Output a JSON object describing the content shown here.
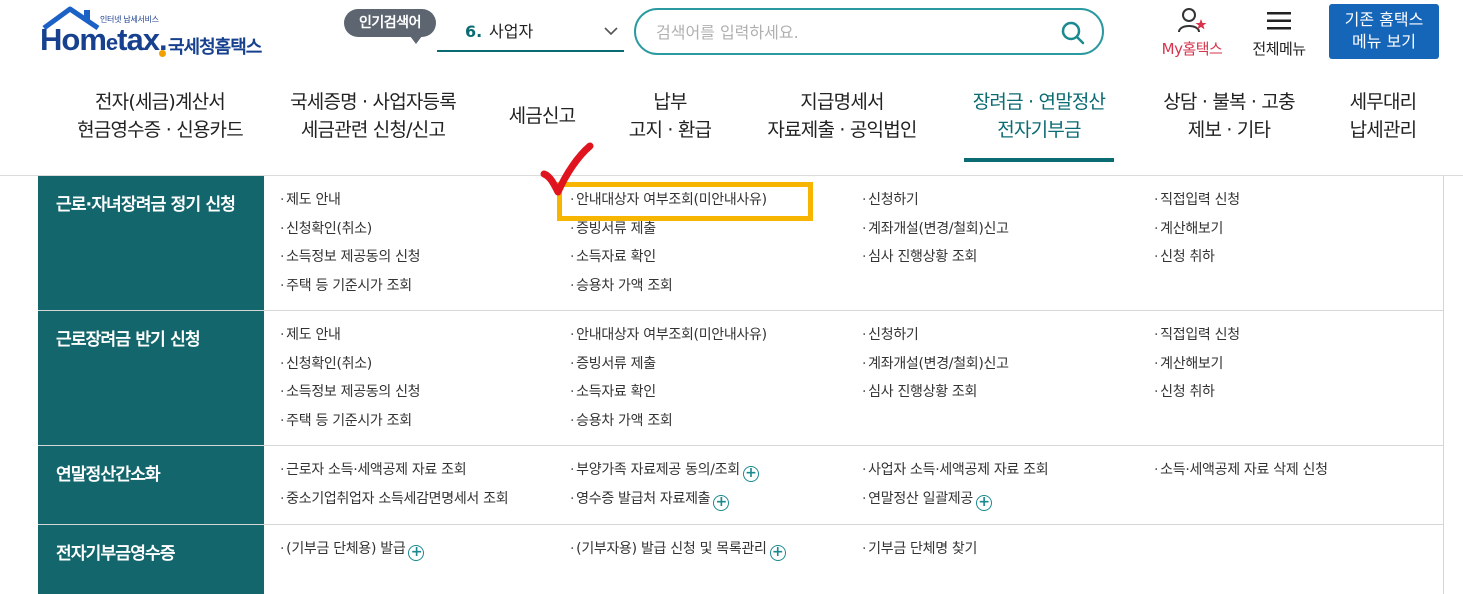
{
  "logo": {
    "subtitle": "인터넷 납세서비스",
    "word_main": "Hom",
    "word_e": "e",
    "word_end": "tax.",
    "korean_name": "국세청홈택스"
  },
  "popular": {
    "badge": "인기검색어",
    "rank": "6.",
    "term": "사업자"
  },
  "search": {
    "placeholder": "검색어를 입력하세요."
  },
  "header": {
    "my_hometax": "My홈택스",
    "all_menu": "전체메뉴",
    "classic_line1": "기존 홈택스",
    "classic_line2": "메뉴 보기"
  },
  "gnb": [
    {
      "line1": "전자(세금)계산서",
      "line2": "현금영수증 · 신용카드"
    },
    {
      "line1": "국세증명 · 사업자등록",
      "line2": "세금관련 신청/신고"
    },
    {
      "line1": "세금신고",
      "line2": ""
    },
    {
      "line1": "납부",
      "line2": "고지 · 환급"
    },
    {
      "line1": "지급명세서",
      "line2": "자료제출 · 공익법인"
    },
    {
      "line1": "장려금 · 연말정산",
      "line2": "전자기부금"
    },
    {
      "line1": "상담 · 불복 · 고충",
      "line2": "제보 · 기타"
    },
    {
      "line1": "세무대리",
      "line2": "납세관리"
    }
  ],
  "sections": [
    {
      "title": "근로·자녀장려금 정기 신청",
      "links": [
        "제도 안내",
        "신청확인(취소)",
        "소득정보 제공동의 신청",
        "주택 등 기준시가 조회",
        "안내대상자 여부조회(미안내사유)",
        "증빙서류 제출",
        "소득자료 확인",
        "승용차 가액 조회",
        "신청하기",
        "계좌개설(변경/철회)신고",
        "심사 진행상황 조회",
        "직접입력 신청",
        "계산해보기",
        "신청 취하"
      ]
    },
    {
      "title": "근로장려금 반기 신청",
      "links": [
        "제도 안내",
        "신청확인(취소)",
        "소득정보 제공동의 신청",
        "주택 등 기준시가 조회",
        "안내대상자 여부조회(미안내사유)",
        "증빙서류 제출",
        "소득자료 확인",
        "승용차 가액 조회",
        "신청하기",
        "계좌개설(변경/철회)신고",
        "심사 진행상황 조회",
        "직접입력 신청",
        "계산해보기",
        "신청 취하"
      ]
    },
    {
      "title": "연말정산간소화",
      "links": [
        "근로자 소득·세액공제 자료 조회",
        "중소기업취업자 소득세감면명세서 조회",
        "부양가족 자료제공 동의/조회",
        "영수증 발급처 자료제출",
        "사업자 소득·세액공제 자료 조회",
        "연말정산 일괄제공",
        "소득·세액공제 자료 삭제 신청"
      ]
    },
    {
      "title": "전자기부금영수증",
      "links": [
        "(기부금 단체용) 발급",
        "(기부자용) 발급 신청 및 목록관리",
        "기부금 단체명 찾기"
      ]
    }
  ],
  "colors": {
    "brand_teal": "#13666c",
    "accent_blue": "#1565b9",
    "highlight": "#f7b500",
    "check_red": "#e0141e"
  }
}
